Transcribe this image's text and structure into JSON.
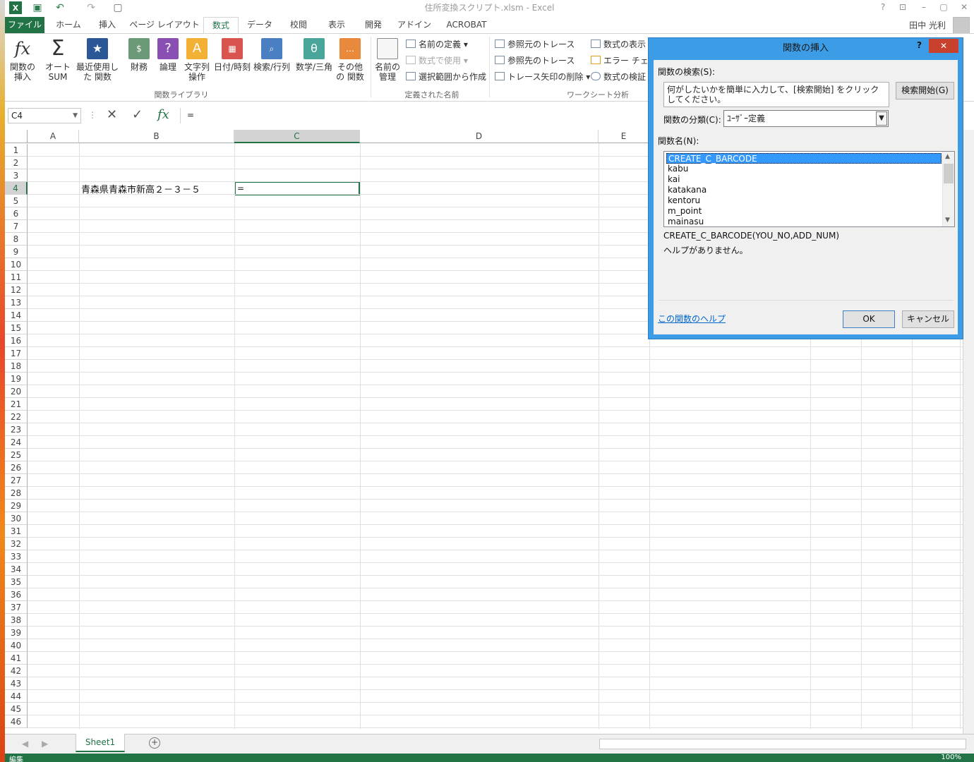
{
  "window": {
    "title": "住所変換スクリプト.xlsm - Excel"
  },
  "user": {
    "name": "田中 光利"
  },
  "tabs": {
    "file": "ファイル",
    "home": "ホーム",
    "insert": "挿入",
    "layout": "ページ レイアウト",
    "formulas": "数式",
    "data": "データ",
    "review": "校閲",
    "view": "表示",
    "dev": "開発",
    "addin": "アドイン",
    "acrobat": "ACROBAT"
  },
  "ribbon": {
    "insert_fn": "関数の挿入",
    "autosum": "オート SUM",
    "recent": "最近使用した 関数",
    "financial": "財務",
    "logical": "論理",
    "text": "文字列 操作",
    "datetime": "日付/時刻",
    "lookup": "検索/行列",
    "math": "数学/三角",
    "more": "その他の 関数",
    "group_lib": "関数ライブラリ",
    "name_mgr": "名前の 管理",
    "define_name": "名前の定義",
    "use_in_formula": "数式で使用",
    "create_from_sel": "選択範囲から作成",
    "group_names": "定義された名前",
    "trace_prec": "参照元のトレース",
    "trace_dep": "参照先のトレース",
    "remove_arrows": "トレース矢印の削除",
    "show_formulas": "数式の表示",
    "error_check": "エラー チェック",
    "evaluate": "数式の検証",
    "group_audit": "ワークシート分析"
  },
  "formula_bar": {
    "name_box": "C4",
    "content": "="
  },
  "columns": [
    "A",
    "B",
    "C",
    "D",
    "E"
  ],
  "rows": [
    "1",
    "2",
    "3",
    "4",
    "5",
    "6",
    "7",
    "8",
    "9",
    "10",
    "11",
    "12",
    "13",
    "14",
    "15",
    "16",
    "17",
    "18",
    "19",
    "20",
    "21",
    "22",
    "23",
    "24",
    "25",
    "26",
    "27",
    "28",
    "29",
    "30",
    "31",
    "32",
    "33",
    "34",
    "35",
    "36",
    "37",
    "38",
    "39",
    "40",
    "41",
    "42",
    "43",
    "44",
    "45",
    "46"
  ],
  "cells": {
    "B4": "青森県青森市新高２－３－５",
    "C4": "="
  },
  "sheet": {
    "tab": "Sheet1"
  },
  "status": {
    "mode": "編集",
    "zoom": "100%"
  },
  "dialog": {
    "title": "関数の挿入",
    "help_char": "?",
    "search_label": "関数の検索(S):",
    "search_text": "何がしたいかを簡単に入力して、[検索開始] をクリックしてください。",
    "go_button": "検索開始(G)",
    "category_label": "関数の分類(C):",
    "category_value": "ﾕｰｻﾞｰ定義",
    "name_label": "関数名(N):",
    "functions": [
      "CREATE_C_BARCODE",
      "kabu",
      "kai",
      "katakana",
      "kentoru",
      "m_point",
      "mainasu"
    ],
    "signature": "CREATE_C_BARCODE(YOU_NO,ADD_NUM)",
    "description": "ヘルプがありません。",
    "help_link": "この関数のヘルプ",
    "ok": "OK",
    "cancel": "キャンセル"
  }
}
